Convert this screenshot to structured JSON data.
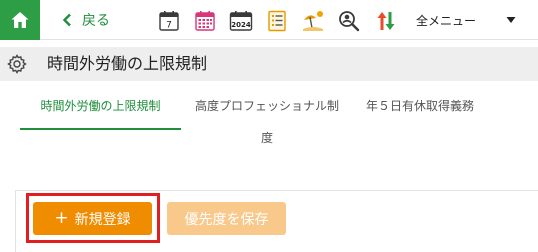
{
  "toolbar": {
    "home_icon": "home-icon",
    "back_label": "戻る",
    "calendar_day": "7",
    "year_label": "2024",
    "all_menu_label": "全メニュー",
    "icons": [
      "calendar-day-icon",
      "calendar-month-icon",
      "calendar-year-icon",
      "list-icon",
      "beach-icon",
      "search-person-icon",
      "sort-icon"
    ]
  },
  "page": {
    "title": "時間外労働の上限規制"
  },
  "tabs": [
    {
      "label": "時間外労働の上限規制",
      "active": true
    },
    {
      "label": "高度プロフェッショナル制度",
      "active": false
    },
    {
      "label": "年５日有休取得義務",
      "active": false
    }
  ],
  "actions": {
    "new_label": "新規登録",
    "new_plus": "+",
    "save_priority_label": "優先度を保存"
  },
  "colors": {
    "brand_green": "#2e9e46",
    "accent_orange": "#f08c00",
    "disabled_orange": "#f9c98c",
    "highlight_red": "#e02020"
  }
}
